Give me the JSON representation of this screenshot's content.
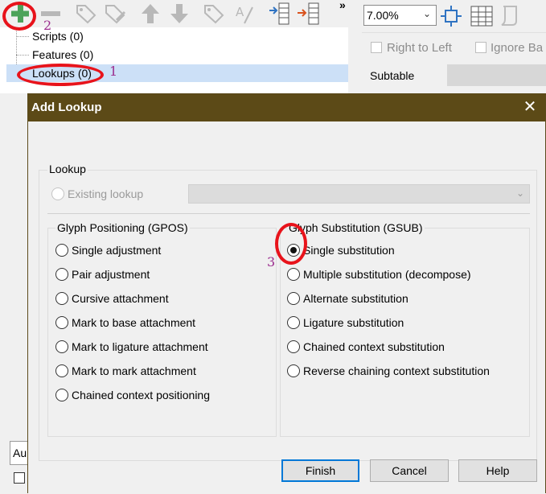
{
  "toolbar": {
    "more_label": "»",
    "icons": [
      "add-icon",
      "remove-icon",
      "tag-icon",
      "tag-edit-icon",
      "arrow-up-icon",
      "arrow-down-icon",
      "tag-flag-icon",
      "spell-icon",
      "merge-table-icon",
      "split-table-icon"
    ]
  },
  "tree": {
    "items": [
      {
        "label": "Scripts (0)"
      },
      {
        "label": "Features (0)"
      },
      {
        "label": "Lookups (0)"
      }
    ]
  },
  "right_panel": {
    "zoom_value": "7.00%",
    "right_to_left_label": "Right to Left",
    "ignore_label": "Ignore Ba",
    "subtable_label": "Subtable"
  },
  "left_panel": {
    "au_label": "Au"
  },
  "dialog": {
    "title": "Add Lookup",
    "close_label": "✕",
    "lookup_group_label": "Lookup",
    "existing_lookup_label": "Existing lookup",
    "gpos_group_label": "Glyph Positioning (GPOS)",
    "gsub_group_label": "Glyph Substitution (GSUB)",
    "gpos_options": [
      {
        "label": "Single adjustment"
      },
      {
        "label": "Pair adjustment"
      },
      {
        "label": "Cursive attachment"
      },
      {
        "label": "Mark to base attachment"
      },
      {
        "label": "Mark to ligature attachment"
      },
      {
        "label": "Mark to mark attachment"
      },
      {
        "label": "Chained context positioning"
      }
    ],
    "gsub_options": [
      {
        "label": "Single substitution",
        "checked": true
      },
      {
        "label": "Multiple substitution (decompose)"
      },
      {
        "label": "Alternate substitution"
      },
      {
        "label": "Ligature substitution"
      },
      {
        "label": "Chained context substitution"
      },
      {
        "label": "Reverse chaining context substitution"
      }
    ],
    "buttons": {
      "finish": "Finish",
      "cancel": "Cancel",
      "help": "Help"
    }
  },
  "annotations": {
    "step1": "1",
    "step2": "2",
    "step3": "3",
    "ring_color": "#e8131b",
    "number_color": "#9b2d8e"
  },
  "colors": {
    "titlebar": "#5c4a17",
    "selection": "#cce0f7",
    "default_button_border": "#0078d7"
  }
}
